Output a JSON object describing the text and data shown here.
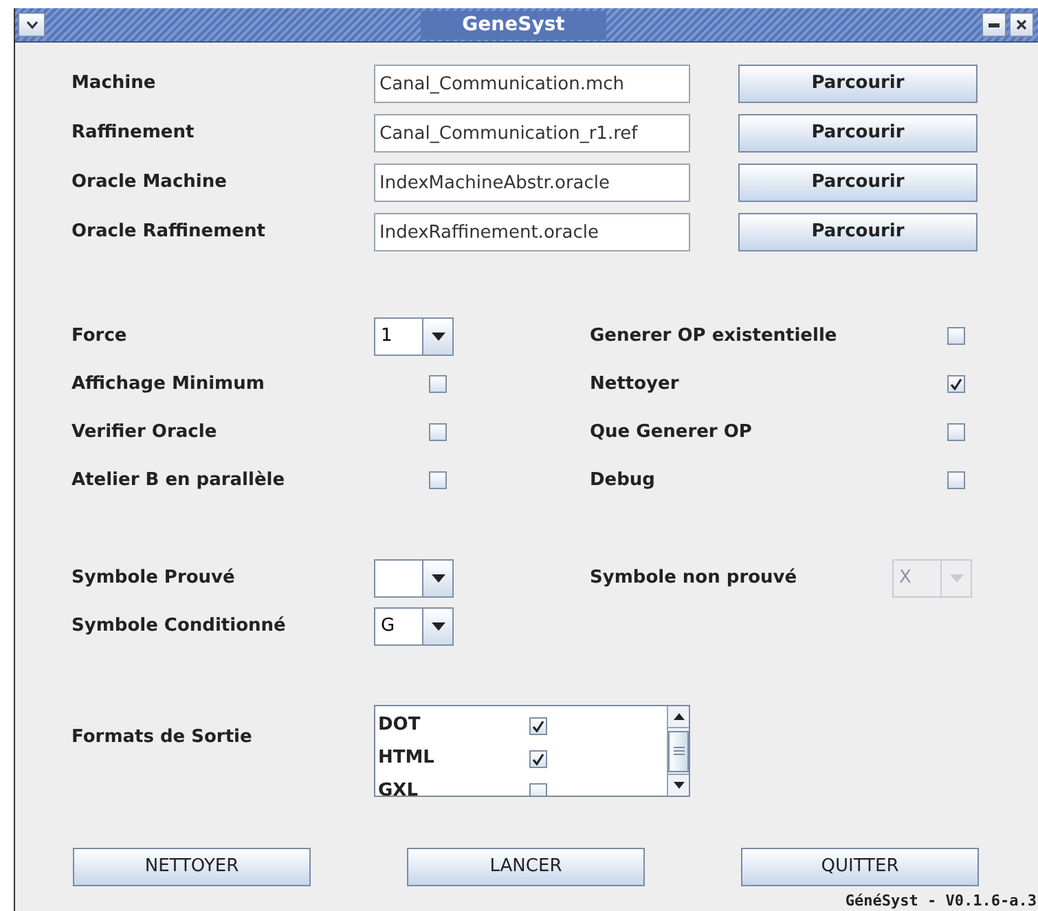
{
  "window": {
    "title": "GeneSyst"
  },
  "files": [
    {
      "label": "Machine",
      "value": "Canal_Communication.mch",
      "button": "Parcourir"
    },
    {
      "label": "Raffinement",
      "value": "Canal_Communication_r1.ref",
      "button": "Parcourir"
    },
    {
      "label": "Oracle Machine",
      "value": "IndexMachineAbstr.oracle",
      "button": "Parcourir"
    },
    {
      "label": "Oracle Raffinement",
      "value": "IndexRaffinement.oracle",
      "button": "Parcourir"
    }
  ],
  "options_left": [
    {
      "label": "Force",
      "kind": "combo",
      "value": "1",
      "disabled": false
    },
    {
      "label": "Affichage Minimum",
      "kind": "checkbox",
      "checked": false
    },
    {
      "label": "Verifier Oracle",
      "kind": "checkbox",
      "checked": false
    },
    {
      "label": "Atelier B en parallèle",
      "kind": "checkbox",
      "checked": false
    }
  ],
  "options_right": [
    {
      "label": "Generer OP existentielle",
      "kind": "checkbox",
      "checked": false
    },
    {
      "label": "Nettoyer",
      "kind": "checkbox",
      "checked": true
    },
    {
      "label": "Que Generer OP",
      "kind": "checkbox",
      "checked": false
    },
    {
      "label": "Debug",
      "kind": "checkbox",
      "checked": false
    }
  ],
  "symbols_left": [
    {
      "label": "Symbole Prouvé",
      "kind": "combo",
      "disabled": false
    },
    {
      "label": "Symbole Conditionné",
      "kind": "combo",
      "value": "G",
      "disabled": false
    }
  ],
  "symbols_right": [
    {
      "label": "Symbole non prouvé",
      "kind": "combo",
      "value": "X",
      "disabled": true
    }
  ],
  "formats": {
    "label": "Formats de Sortie",
    "items": [
      {
        "name": "DOT",
        "checked": true
      },
      {
        "name": "HTML",
        "checked": true
      },
      {
        "name": "GXL",
        "checked": false
      }
    ]
  },
  "buttons": [
    "NETTOYER",
    "LANCER",
    "QUITTER"
  ],
  "status_bar": {
    "version": "GénéSyst - V0.1.6-a.3"
  }
}
